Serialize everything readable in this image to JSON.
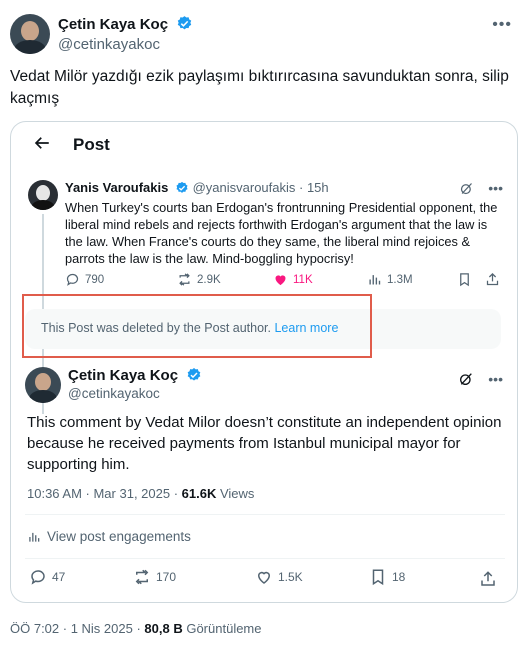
{
  "outer": {
    "name": "Çetin Kaya Koç",
    "handle": "@cetinkayakoc",
    "text": "Vedat Milör yazdığı ezik paylaşımı bıktırırcasına savunduktan sonra, silip kaçmış"
  },
  "card": {
    "title": "Post",
    "quoted": {
      "name": "Yanis Varoufakis",
      "handle": "@yanisvaroufakis",
      "time": "· 15h",
      "text": "When Turkey's courts ban Erdogan's frontrunning Presidential opponent, the liberal mind rebels and rejects forthwith Erdogan's argument that the law is the law. When France's courts do they same, the liberal mind rejoices & parrots the law is the law. Mind-boggling hypocrisy!",
      "replies": "790",
      "reposts": "2.9K",
      "likes": "11K",
      "views": "1.3M"
    },
    "deleted": {
      "text": "This Post was deleted by the Post author.",
      "link": "Learn more"
    },
    "reply": {
      "name": "Çetin Kaya Koç",
      "handle": "@cetinkayakoc",
      "text": "This comment by Vedat Milor doesn’t constitute an independent opinion because he received payments from Istanbul municipal mayor for supporting him.",
      "timestamp": "10:36 AM · Mar 31, 2025 ·",
      "views_count": "61.6K",
      "views_label": "Views",
      "engagements": "View post engagements",
      "replies": "47",
      "reposts": "170",
      "likes": "1.5K",
      "bookmarks": "18"
    }
  },
  "footer": {
    "time": "ÖÖ 7:02 · 1 Nis 2025 ·",
    "views_count": "80,8 B",
    "views_label": "Görüntüleme"
  },
  "colors": {
    "accent": "#1d9bf0",
    "like": "#f91880",
    "highlight": "#e05c4b",
    "muted": "#536471"
  }
}
